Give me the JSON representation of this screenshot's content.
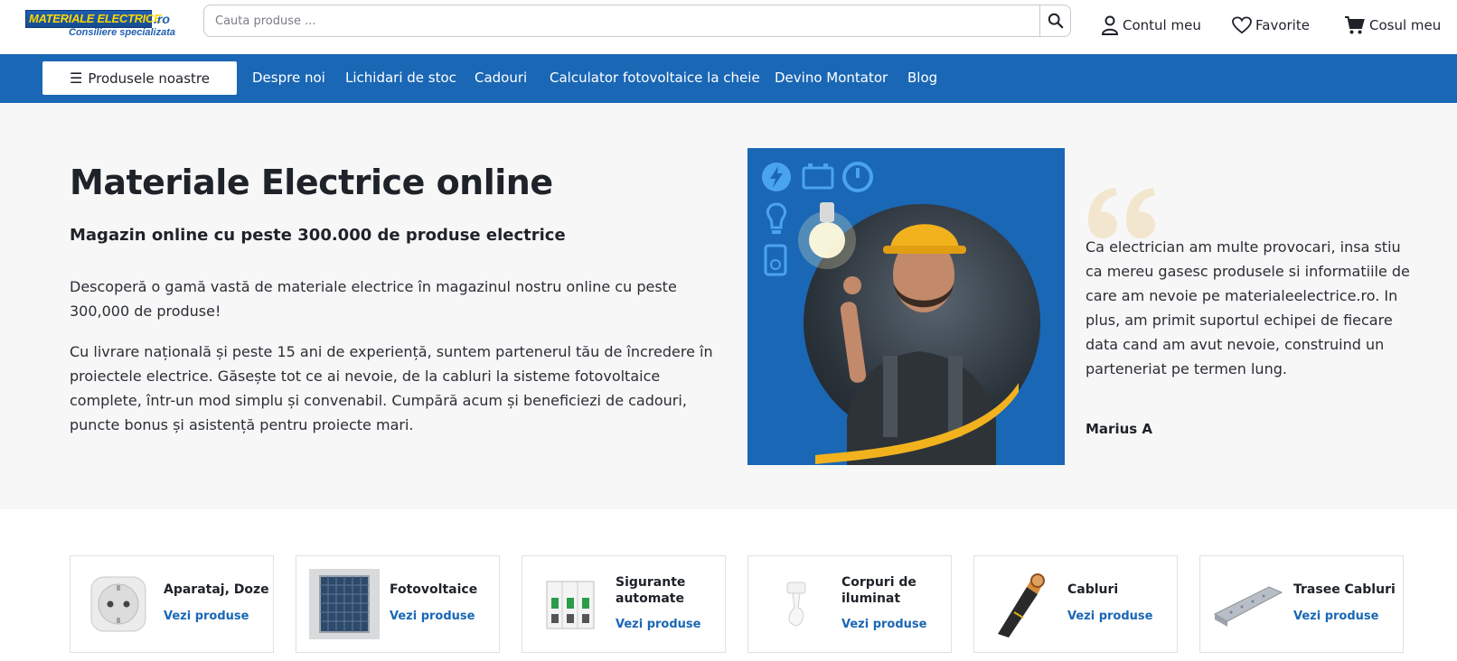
{
  "header": {
    "logo": {
      "line1": "MATERIALE ELECTRICE",
      "tld": ".ro",
      "tagline": "Consiliere specializata"
    },
    "search": {
      "placeholder": "Cauta produse ...",
      "value": ""
    },
    "links": {
      "account": "Contul meu",
      "favorites": "Favorite",
      "cart": "Cosul meu"
    }
  },
  "nav": {
    "products_label": "Produsele noastre",
    "items": [
      "Despre noi",
      "Lichidari de stoc",
      "Cadouri",
      "Calculator fotovoltaice la cheie",
      "Devino Montator",
      "Blog"
    ]
  },
  "hero": {
    "title": "Materiale Electrice online",
    "subtitle": "Magazin online cu peste 300.000 de produse electrice",
    "paragraph1": "Descoperă o gamă vastă de materiale electrice în magazinul nostru online cu peste 300,000 de produse!",
    "paragraph2": "Cu livrare națională și peste 15 ani de experiență, suntem partenerul tău de încredere în proiectele electrice. Găsește tot ce ai nevoie, de la cabluri la sisteme fotovoltaice complete, într-un mod simplu și convenabil. Cumpără acum și beneficiezi de cadouri, puncte bonus și asistență pentru proiecte mari.",
    "testimonial": {
      "text": "Ca electrician am multe provocari, insa stiu ca mereu gasesc produsele si informatiile de care am nevoie pe materialeelectrice.ro. In plus, am primit suportul echipei de fiecare data cand am avut nevoie, construind un parteneriat pe termen lung.",
      "author": "Marius A"
    }
  },
  "categories": [
    {
      "title": "Aparataj, Doze",
      "link": "Vezi produse",
      "icon": "socket-icon"
    },
    {
      "title": "Fotovoltaice",
      "link": "Vezi produse",
      "icon": "solar-panel-icon"
    },
    {
      "title": "Sigurante automate",
      "link": "Vezi produse",
      "icon": "circuit-breaker-icon"
    },
    {
      "title": "Corpuri de iluminat",
      "link": "Vezi produse",
      "icon": "lamp-icon"
    },
    {
      "title": "Cabluri",
      "link": "Vezi produse",
      "icon": "cable-icon"
    },
    {
      "title": "Trasee Cabluri",
      "link": "Vezi produse",
      "icon": "cable-tray-icon"
    }
  ],
  "colors": {
    "brand_blue": "#1a67b5",
    "accent_yellow": "#ffd700",
    "quote_mark": "#f3e6cf"
  }
}
